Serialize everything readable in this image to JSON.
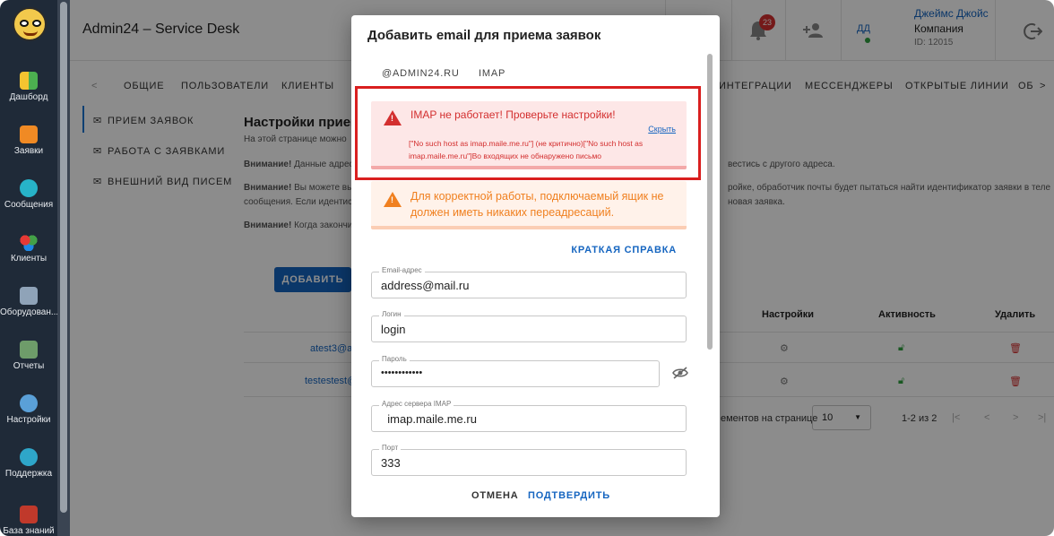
{
  "header": {
    "app_title": "Admin24 – Service Desk",
    "notification_count": "23",
    "user_initials": "ДД",
    "user_name": "Джеймс Джойс",
    "user_company": "Компания",
    "user_id": "ID: 12015"
  },
  "sidebar": {
    "items": [
      {
        "label": "Дашборд",
        "icon": "dashboard-icon"
      },
      {
        "label": "Заявки",
        "icon": "megaphone-icon"
      },
      {
        "label": "Сообщения",
        "icon": "chat-icon"
      },
      {
        "label": "Клиенты",
        "icon": "clients-icon"
      },
      {
        "label": "Оборудован...",
        "icon": "equipment-icon"
      },
      {
        "label": "Отчеты",
        "icon": "reports-icon"
      },
      {
        "label": "Настройки",
        "icon": "gear-icon"
      },
      {
        "label": "Поддержка",
        "icon": "help-icon"
      },
      {
        "label": "База знаний",
        "icon": "book-icon"
      }
    ]
  },
  "tabs": {
    "items": [
      "ОБЩИЕ",
      "ПОЛЬЗОВАТЕЛИ",
      "КЛИЕНТЫ",
      "ИНТЕГРАЦИИ",
      "МЕССЕНДЖЕРЫ",
      "ОТКРЫТЫЕ ЛИНИИ",
      "ОБ"
    ]
  },
  "subnav": {
    "items": [
      "ПРИЕМ ЗАЯВОК",
      "РАБОТА С ЗАЯВКАМИ",
      "ВНЕШНИЙ ВИД ПИСЕМ"
    ]
  },
  "page": {
    "title": "Настройки прием",
    "intro": "На этой странице можно",
    "note1_bold": "Внимание!",
    "note1": "Данные адрес",
    "note1_tail": "вестись с другого адреса.",
    "note2_bold": "Внимание!",
    "note2": "Вы можете вы",
    "note2_tail": "ройке, обработчик почты будет пытаться найти идентификатор заявки в теле",
    "note2b": "сообщения. Если идентис",
    "note2b_tail": "новая заявка.",
    "note3_bold": "Внимание!",
    "note3": "Когда закончи",
    "add_button": "ДОБАВИТЬ"
  },
  "table": {
    "headers": {
      "settings": "Настройки",
      "active": "Активность",
      "delete": "Удалить"
    },
    "rows": [
      {
        "email": "atest3@ac"
      },
      {
        "email": "testestest@"
      }
    ],
    "per_page_label": "ементов на странице",
    "per_page_value": "10",
    "range": "1-2 из 2"
  },
  "modal": {
    "title": "Добавить email для приема заявок",
    "tabs": [
      "@ADMIN24.RU",
      "IMAP"
    ],
    "error": {
      "title": "IMAP не работает! Проверьте настройки!",
      "hide_link": "Скрыть",
      "details": "[\"No such host as imap.maile.me.ru\"] (не критично)[\"No such host as imap.maile.me.ru\"]Во входящих не обнаружено письмо"
    },
    "warning": "Для корректной работы, подключаемый ящик не должен иметь никаких переадресаций.",
    "help_link": "КРАТКАЯ СПРАВКА",
    "fields": {
      "email": {
        "label": "Email-адрес",
        "value": "address@mail.ru"
      },
      "login": {
        "label": "Логин",
        "value": "login"
      },
      "password": {
        "label": "Пароль",
        "value": "••••••••••••"
      },
      "server": {
        "label": "Адрес сервера IMAP",
        "value": "  imap.maile.me.ru"
      },
      "port": {
        "label": "Порт",
        "value": "333"
      }
    },
    "cancel": "ОТМЕНА",
    "confirm": "ПОДТВЕРДИТЬ"
  },
  "colors": {
    "primary": "#1565c0",
    "error": "#d32f2f",
    "warning": "#f08020",
    "sidebar": "#1f2a38"
  }
}
